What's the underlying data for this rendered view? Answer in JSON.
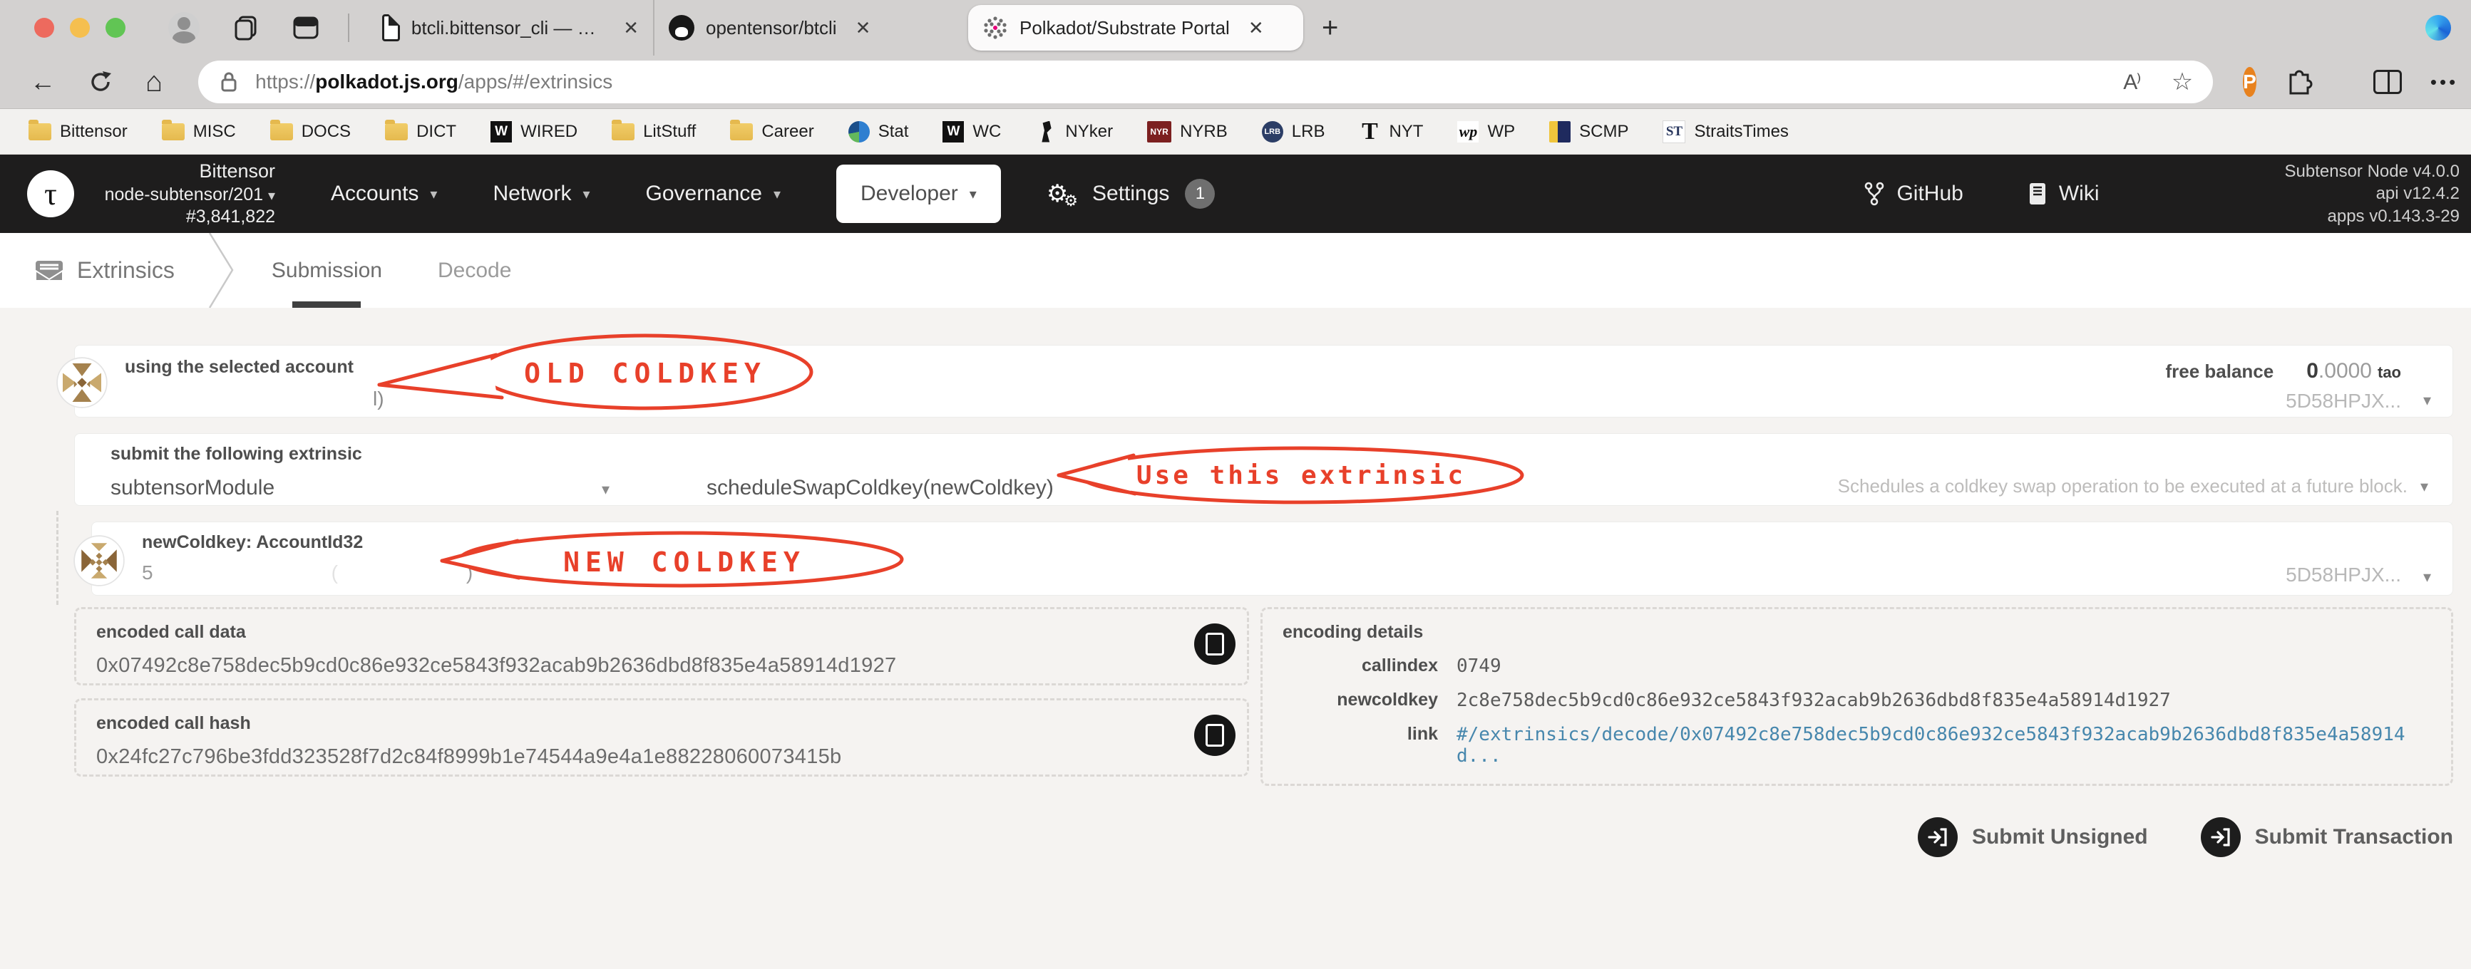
{
  "browser": {
    "tabs": [
      {
        "title": "btcli.bittensor_cli — BTCLI Docs",
        "icon": "document-icon"
      },
      {
        "title": "opentensor/btcli",
        "icon": "github-icon"
      },
      {
        "title": "Polkadot/Substrate Portal",
        "icon": "polkadot-icon"
      }
    ],
    "close_glyph": "✕",
    "new_tab_glyph": "+",
    "url": {
      "scheme": "https://",
      "host": "polkadot.js.org",
      "path": "/apps/#/extrinsics"
    },
    "nav": {
      "back": "←",
      "home": "⌂",
      "more": "•••",
      "read_aloud": "A⁾",
      "star": "☆",
      "extension_badge": "P"
    },
    "bookmarks": [
      {
        "label": "Bittensor"
      },
      {
        "label": "MISC"
      },
      {
        "label": "DOCS"
      },
      {
        "label": "DICT"
      },
      {
        "label": "WIRED"
      },
      {
        "label": "LitStuff"
      },
      {
        "label": "Career"
      },
      {
        "label": "Stat"
      },
      {
        "label": "WC"
      },
      {
        "label": "NYker"
      },
      {
        "label": "NYRB"
      },
      {
        "label": "LRB"
      },
      {
        "label": "NYT"
      },
      {
        "label": "WP"
      },
      {
        "label": "SCMP"
      },
      {
        "label": "StraitsTimes"
      }
    ],
    "bookmark_icon_text": {
      "wired": "W",
      "wc": "W",
      "nyrb": "NYR",
      "lrb": "LRB",
      "nyt": "T",
      "wapo": "wp",
      "straits": "ST"
    }
  },
  "header": {
    "logo_glyph": "τ",
    "chain": "Bittensor",
    "node": "node-subtensor/201",
    "block": "#3,841,822",
    "menus": [
      {
        "label": "Accounts"
      },
      {
        "label": "Network"
      },
      {
        "label": "Governance"
      },
      {
        "label": "Developer"
      }
    ],
    "settings": {
      "label": "Settings",
      "badge": "1",
      "gear": "⚙"
    },
    "links": [
      {
        "label": "GitHub"
      },
      {
        "label": "Wiki"
      }
    ],
    "versions": [
      "Subtensor Node v4.0.0",
      "api v12.4.2",
      "apps v0.143.3-29"
    ],
    "caret": "▾"
  },
  "subnav": {
    "section": "Extrinsics",
    "tabs": [
      {
        "label": "Submission"
      },
      {
        "label": "Decode"
      }
    ]
  },
  "form": {
    "account": {
      "label": "using the selected account",
      "value_fragment": "l)",
      "free_balance_label": "free balance",
      "balance_int": "0",
      "balance_dec": ".0000",
      "balance_unit": "tao",
      "address_short": "5D58HPJX...",
      "caret": "▾"
    },
    "extrinsic": {
      "label": "submit the following extrinsic",
      "module": "subtensorModule",
      "method": "scheduleSwapColdkey(newColdkey)",
      "description": "Schedules a coldkey swap operation to be executed at a future block.",
      "caret": "▾"
    },
    "param": {
      "label": "newColdkey: AccountId32",
      "value_start": "5",
      "value_end": ")",
      "address_short": "5D58HPJX...",
      "caret": "▾"
    }
  },
  "output": {
    "call_data": {
      "label": "encoded call data",
      "value": "0x07492c8e758dec5b9cd0c86e932ce5843f932acab9b2636dbd8f835e4a58914d1927"
    },
    "call_hash": {
      "label": "encoded call hash",
      "value": "0x24fc27c796be3fdd323528f7d2c84f8999b1e74544a9e4a1e88228060073415b"
    },
    "details": {
      "label": "encoding details",
      "rows": [
        {
          "key": "callindex",
          "value": "0749"
        },
        {
          "key": "newcoldkey",
          "value": "2c8e758dec5b9cd0c86e932ce5843f932acab9b2636dbd8f835e4a58914d1927"
        },
        {
          "key": "link",
          "value": "#/extrinsics/decode/0x07492c8e758dec5b9cd0c86e932ce5843f932acab9b2636dbd8f835e4a58914d..."
        }
      ]
    }
  },
  "actions": {
    "submit_unsigned": "Submit Unsigned",
    "submit_transaction": "Submit Transaction"
  },
  "annotations": {
    "old_coldkey": "OLD COLDKEY",
    "use_extrinsic": "Use this extrinsic",
    "new_coldkey": "NEW COLDKEY",
    "color": "#e8402a"
  }
}
